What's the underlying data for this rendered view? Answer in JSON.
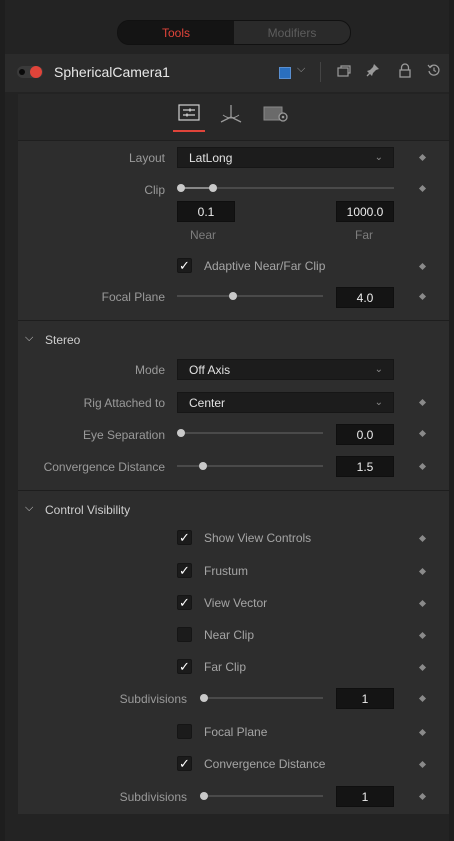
{
  "tabs": {
    "tools": "Tools",
    "modifiers": "Modifiers"
  },
  "header": {
    "title": "SphericalCamera1"
  },
  "camera": {
    "layout_label": "Layout",
    "layout_value": "LatLong",
    "clip_label": "Clip",
    "near_value": "0.1",
    "far_value": "1000.0",
    "near_label": "Near",
    "far_label": "Far",
    "adaptive_label": "Adaptive Near/Far Clip",
    "focal_plane_label": "Focal Plane",
    "focal_plane_value": "4.0"
  },
  "stereo": {
    "title": "Stereo",
    "mode_label": "Mode",
    "mode_value": "Off Axis",
    "rig_label": "Rig Attached to",
    "rig_value": "Center",
    "eye_label": "Eye Separation",
    "eye_value": "0.0",
    "conv_label": "Convergence Distance",
    "conv_value": "1.5"
  },
  "visibility": {
    "title": "Control Visibility",
    "show_view_controls": "Show View Controls",
    "frustum": "Frustum",
    "view_vector": "View Vector",
    "near_clip": "Near Clip",
    "far_clip": "Far Clip",
    "subdivisions_label": "Subdivisions",
    "subdivisions_value": "1",
    "focal_plane": "Focal Plane",
    "convergence_distance": "Convergence Distance",
    "subdivisions2_label": "Subdivisions",
    "subdivisions2_value": "1"
  },
  "colors": {
    "accent": "#e0443a",
    "swatch": "#2a6fbf"
  }
}
